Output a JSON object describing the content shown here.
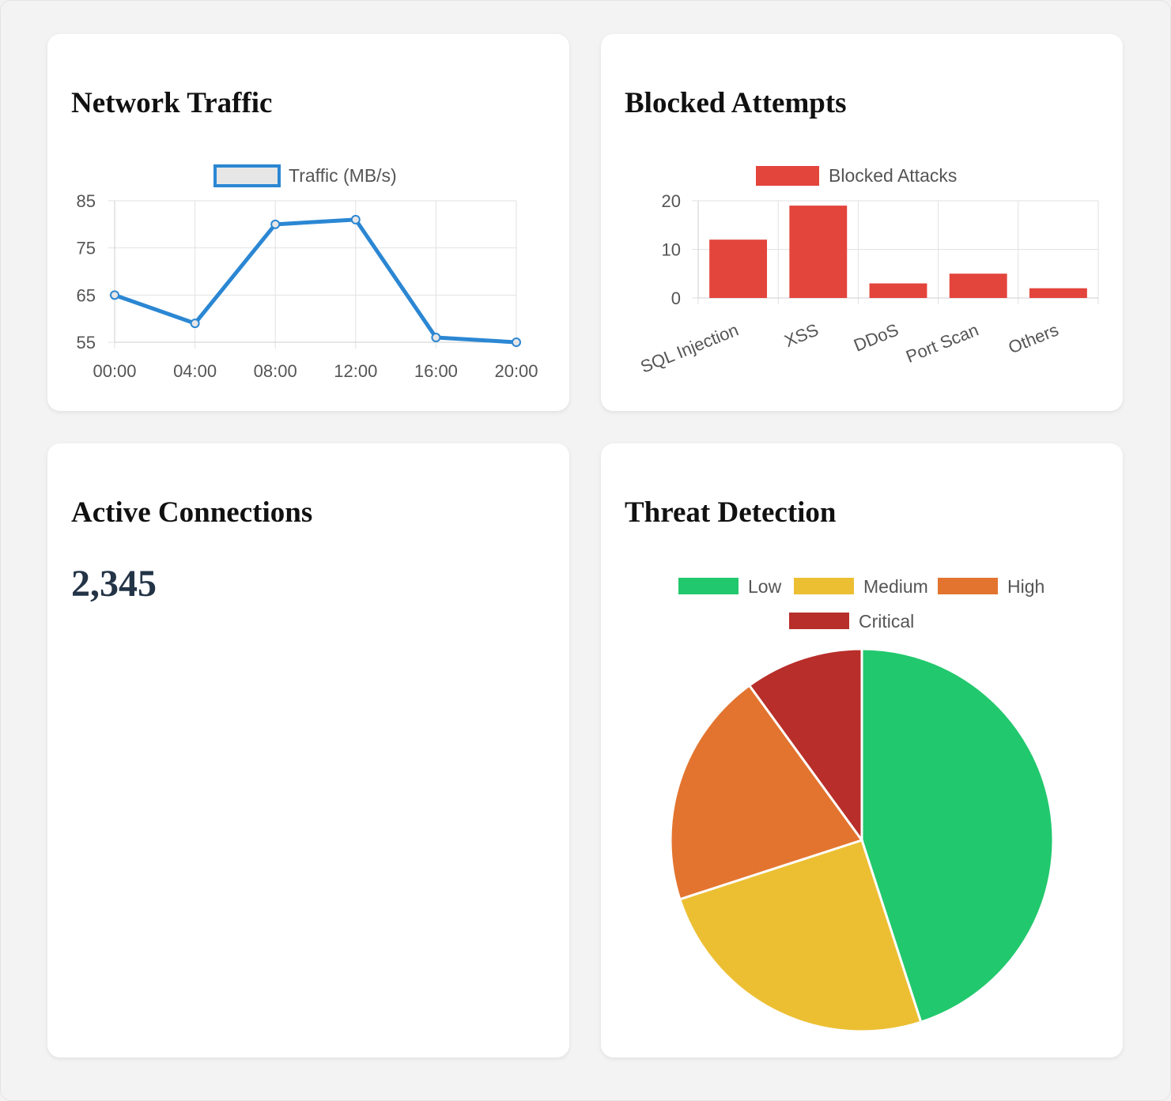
{
  "cards": {
    "traffic_title": "Network Traffic",
    "blocked_title": "Blocked Attempts",
    "connections_title": "Active Connections",
    "connections_value": "2,345",
    "threat_title": "Threat Detection"
  },
  "chart_data": [
    {
      "type": "line",
      "title": "Network Traffic",
      "x": [
        "00:00",
        "04:00",
        "08:00",
        "12:00",
        "16:00",
        "20:00"
      ],
      "series": [
        {
          "name": "Traffic (MB/s)",
          "values": [
            65,
            59,
            80,
            81,
            56,
            55
          ],
          "color": "#2b87d3"
        }
      ],
      "ylim": [
        55,
        85
      ],
      "yticks": [
        85,
        75,
        65,
        55
      ],
      "grid": true,
      "legend": "top-center"
    },
    {
      "type": "bar",
      "title": "Blocked Attempts",
      "categories": [
        "SQL Injection",
        "XSS",
        "DDoS",
        "Port Scan",
        "Others"
      ],
      "series": [
        {
          "name": "Blocked Attacks",
          "values": [
            12,
            19,
            3,
            5,
            2
          ],
          "color": "#e3443c"
        }
      ],
      "ylim": [
        0,
        20
      ],
      "yticks": [
        20,
        10,
        0
      ],
      "grid": true,
      "legend": "top-center"
    },
    {
      "type": "pie",
      "title": "Threat Detection",
      "labels": [
        "Low",
        "Medium",
        "High",
        "Critical"
      ],
      "values": [
        45,
        25,
        20,
        10
      ],
      "colors": [
        "#22c86d",
        "#ecbf33",
        "#e3742f",
        "#b82e2a"
      ],
      "legend": "top-center"
    }
  ]
}
